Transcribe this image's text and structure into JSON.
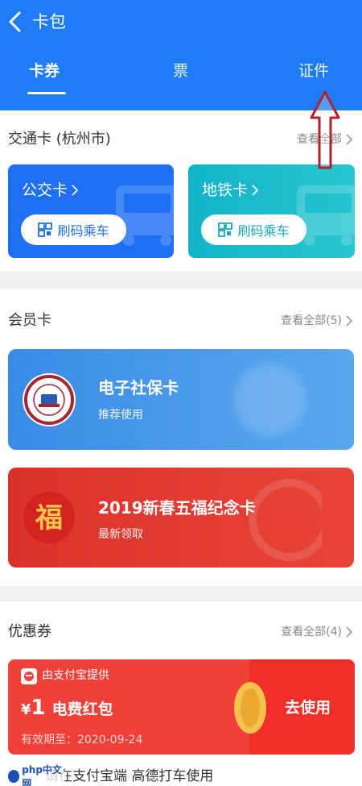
{
  "header": {
    "title": "卡包",
    "tabs": [
      {
        "label": "卡券",
        "active": true
      },
      {
        "label": "票",
        "active": false
      },
      {
        "label": "证件",
        "active": false
      }
    ]
  },
  "transit": {
    "title": "交通卡 (杭州市)",
    "more": "查看全部",
    "cards": [
      {
        "name": "公交卡",
        "button": "刷码乘车",
        "color": "#1f6ff2"
      },
      {
        "name": "地铁卡",
        "button": "刷码乘车",
        "color": "#1ab8c8"
      }
    ]
  },
  "membership": {
    "title": "会员卡",
    "more": "查看全部(5)",
    "cards": [
      {
        "name": "电子社保卡",
        "sub": "推荐使用",
        "icon": "social-security-seal-icon",
        "color": "#3d8fe6"
      },
      {
        "name": "2019新春五福纪念卡",
        "sub": "最新领取",
        "icon": "fu-character-icon",
        "color": "#e2392e"
      }
    ]
  },
  "coupons": {
    "title": "优惠券",
    "more": "查看全部(4)",
    "items": [
      {
        "provider": "由支付宝提供",
        "currency": "¥",
        "amount": "1",
        "name": "电费红包",
        "expiry": "有效期至：2020-09-24",
        "action": "去使用"
      }
    ]
  },
  "footer": {
    "partial_text": "请在支付宝端 高德打车使用",
    "watermark": "php中文网"
  }
}
